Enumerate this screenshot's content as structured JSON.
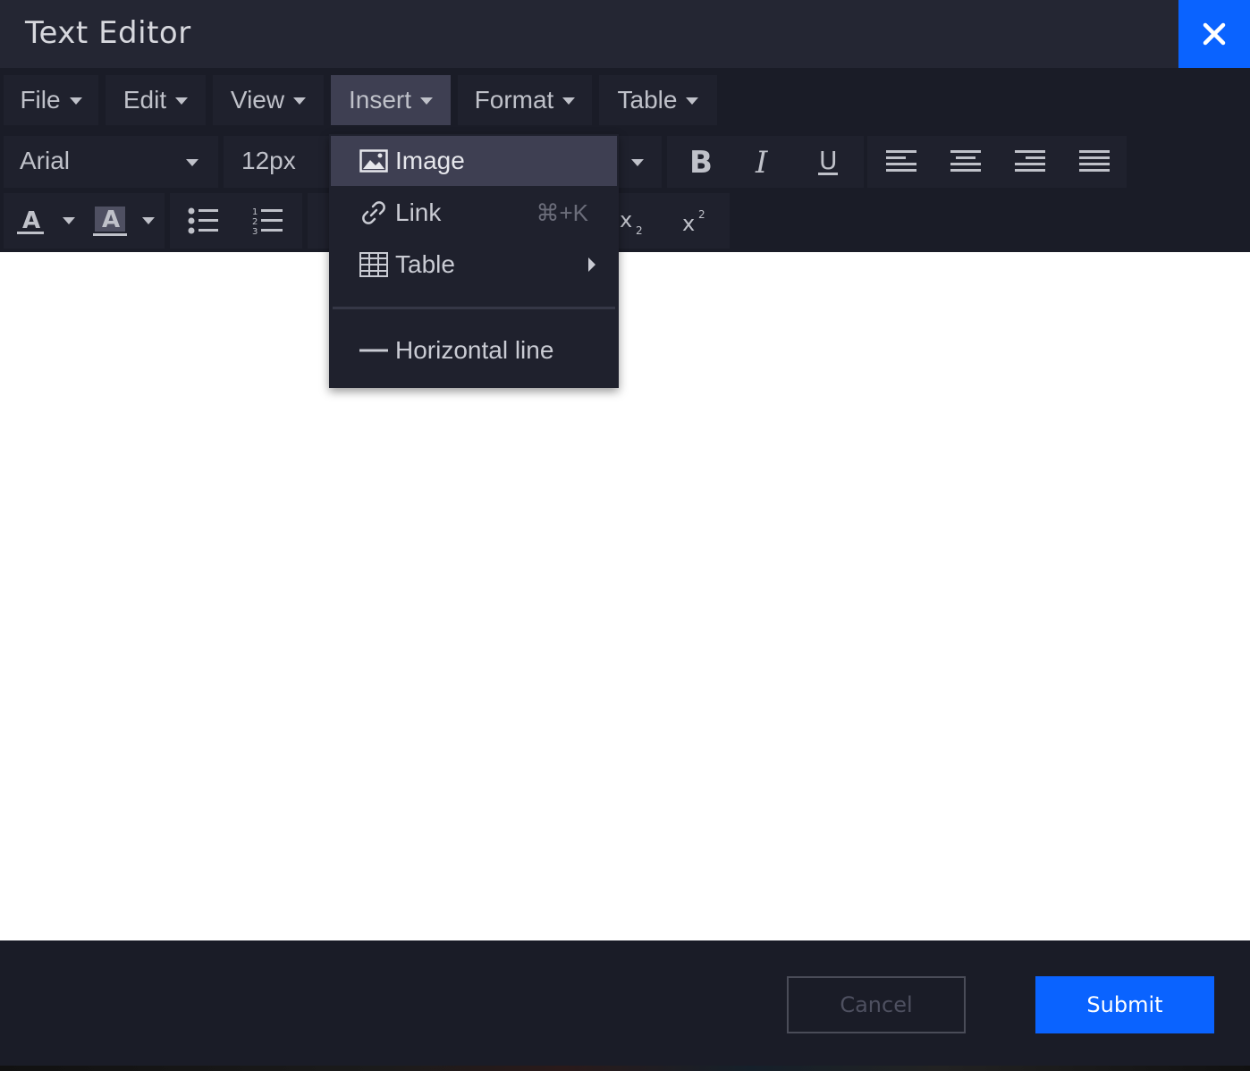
{
  "window": {
    "title": "Text Editor"
  },
  "menubar": {
    "items": [
      {
        "label": "File"
      },
      {
        "label": "Edit"
      },
      {
        "label": "View"
      },
      {
        "label": "Insert",
        "active": true
      },
      {
        "label": "Format"
      },
      {
        "label": "Table"
      }
    ]
  },
  "toolbar": {
    "font_family": "Arial",
    "font_size": "12px",
    "buttons": [
      "bold-icon",
      "italic-icon",
      "underline-icon",
      "align-left-icon",
      "align-center-icon",
      "align-right-icon",
      "align-justify-icon",
      "text-color-icon",
      "highlight-color-icon",
      "bullet-list-icon",
      "numbered-list-icon",
      "subscript-icon",
      "superscript-icon"
    ]
  },
  "insert_menu": {
    "items": [
      {
        "label": "Image",
        "icon": "image-icon",
        "highlighted": true
      },
      {
        "label": "Link",
        "icon": "link-icon",
        "shortcut": "⌘+K"
      },
      {
        "label": "Table",
        "icon": "table-grid-icon",
        "submenu": true
      },
      {
        "label": "Horizontal line",
        "icon": "horizontal-line-icon"
      }
    ]
  },
  "footer": {
    "cancel_label": "Cancel",
    "submit_label": "Submit"
  },
  "colors": {
    "accent": "#0a63ff",
    "background": "#1a1c27",
    "panel": "#1f212d",
    "highlight": "#3e3f52"
  }
}
